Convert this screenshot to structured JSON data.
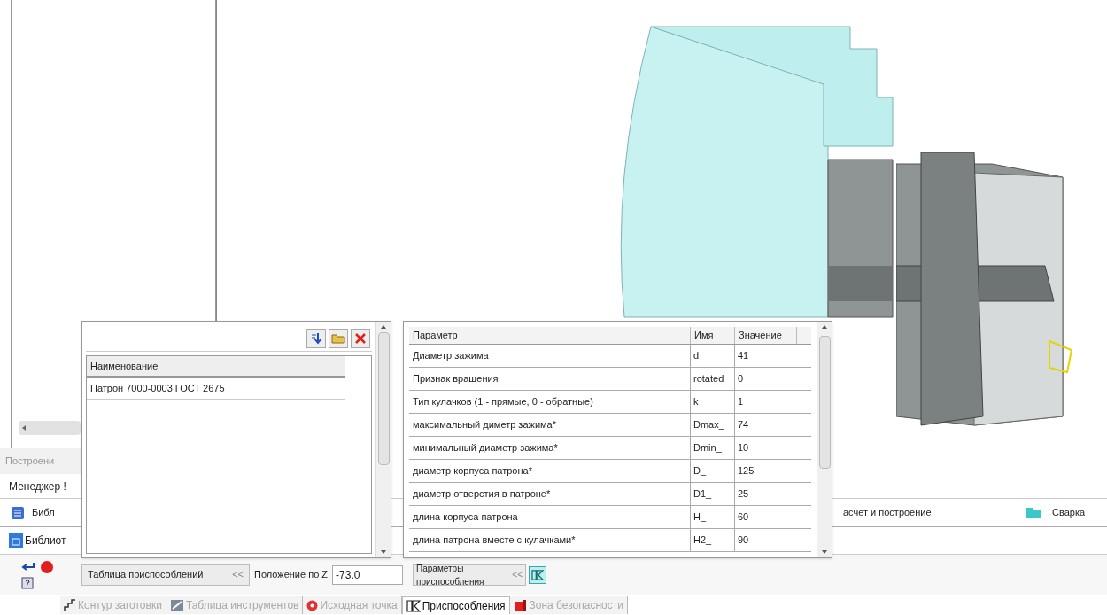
{
  "left_panel": {
    "tab_label": "Построени",
    "manager_title": "Менеджер !",
    "library_row_label": "Библ",
    "library_tab_label": "Библиот"
  },
  "background_row": {
    "calc_label": "асчет и построение",
    "folder_label": "Сварка"
  },
  "fixtures_panel": {
    "column": "Наименование",
    "rows": [
      {
        "name": "Патрон 7000-0003 ГОСТ 2675"
      }
    ]
  },
  "params_panel": {
    "columns": [
      "Параметр",
      "Имя",
      "Значение"
    ],
    "rows": [
      {
        "parameter": "Диаметр зажима",
        "name": "d",
        "value": "41"
      },
      {
        "parameter": "Признак вращения",
        "name": "rotated",
        "value": "0"
      },
      {
        "parameter": "Тип кулачков (1 - прямые, 0 - обратные)",
        "name": "k",
        "value": "1"
      },
      {
        "parameter": "максимальный диметр зажима*",
        "name": "Dmax_",
        "value": "74"
      },
      {
        "parameter": "минимальный диаметр зажима*",
        "name": "Dmin_",
        "value": "10"
      },
      {
        "parameter": "диаметр корпуса патрона*",
        "name": "D_",
        "value": "125"
      },
      {
        "parameter": "диаметр отверстия в патроне*",
        "name": "D1_",
        "value": "25"
      },
      {
        "parameter": "длина корпуса патрона",
        "name": "H_",
        "value": "60"
      },
      {
        "parameter": "длина патрона вместе с кулачками*",
        "name": "H2_",
        "value": "90"
      }
    ]
  },
  "footer": {
    "fixture_table_label": "Таблица приспособлений",
    "fixture_table_toggle": "<<",
    "z_label": "Положение по Z",
    "z_value": "-73.0",
    "params_label": "Параметры приспособления",
    "params_toggle": "<<"
  },
  "bottom_tabs": [
    {
      "label": "Контур заготовки",
      "kind": "contour",
      "selected": false
    },
    {
      "label": "Таблица инструментов",
      "kind": "tools",
      "selected": false
    },
    {
      "label": "Исходная точка",
      "kind": "origin",
      "selected": false
    },
    {
      "label": "Приспособления",
      "kind": "fixtures",
      "selected": true
    },
    {
      "label": "Зона безопасности",
      "kind": "safety",
      "selected": false
    }
  ]
}
